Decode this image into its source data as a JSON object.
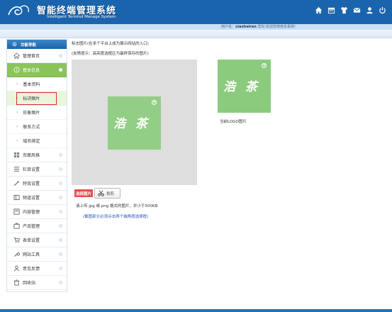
{
  "header": {
    "title": "智能终端管理系统",
    "subtitle": "Intelligent  Termind  Manage  System"
  },
  "userbar": {
    "prefix": "用户名：",
    "username": "xiaoheiren",
    "suffix": " 您好,欢迎您使用本系统!"
  },
  "sidebar": {
    "head": "功能导航",
    "items": [
      {
        "label": "管理首页",
        "icon": "home-icon"
      },
      {
        "label": "基本信息",
        "icon": "info-icon",
        "active": true
      },
      {
        "label": "基本资料",
        "sub": true
      },
      {
        "label": "标识图片",
        "sub": true,
        "current": true
      },
      {
        "label": "形象图片",
        "sub": true
      },
      {
        "label": "联系方式",
        "sub": true
      },
      {
        "label": "域名绑定",
        "sub": true
      },
      {
        "label": "页面风格",
        "icon": "grid-icon"
      },
      {
        "label": "栏目设置",
        "icon": "list-icon"
      },
      {
        "label": "特效设置",
        "icon": "magic-icon"
      },
      {
        "label": "频道设置",
        "icon": "channel-icon"
      },
      {
        "label": "内容管理",
        "icon": "content-icon"
      },
      {
        "label": "产品管理",
        "icon": "product-icon"
      },
      {
        "label": "表单设置",
        "icon": "cart-icon"
      },
      {
        "label": "网站工具",
        "icon": "wrench-icon"
      },
      {
        "label": "意见反馈",
        "icon": "user-icon"
      },
      {
        "label": "回收站",
        "icon": "trash-icon"
      }
    ]
  },
  "content": {
    "title": "标志图片(在多个平台上成为展示网站的入口)",
    "tip": "(友情提示：高亮度选框区为最终保存的图片)",
    "logo_text": "浩 茶",
    "preview_label": "当前LOGO图片",
    "choose_label": "选择图片",
    "cut_label": "裁剪",
    "upload_hint": "请上传 jpg 或 png 格式的图片，并小于500KB",
    "upload_note": "(截图部分必须点击两个端角度选择框)"
  },
  "colors": {
    "header": "#1a64ad",
    "active_nav": "#8bc45a",
    "choose_button": "#e14f4f",
    "logo_green": "#93ce86"
  }
}
